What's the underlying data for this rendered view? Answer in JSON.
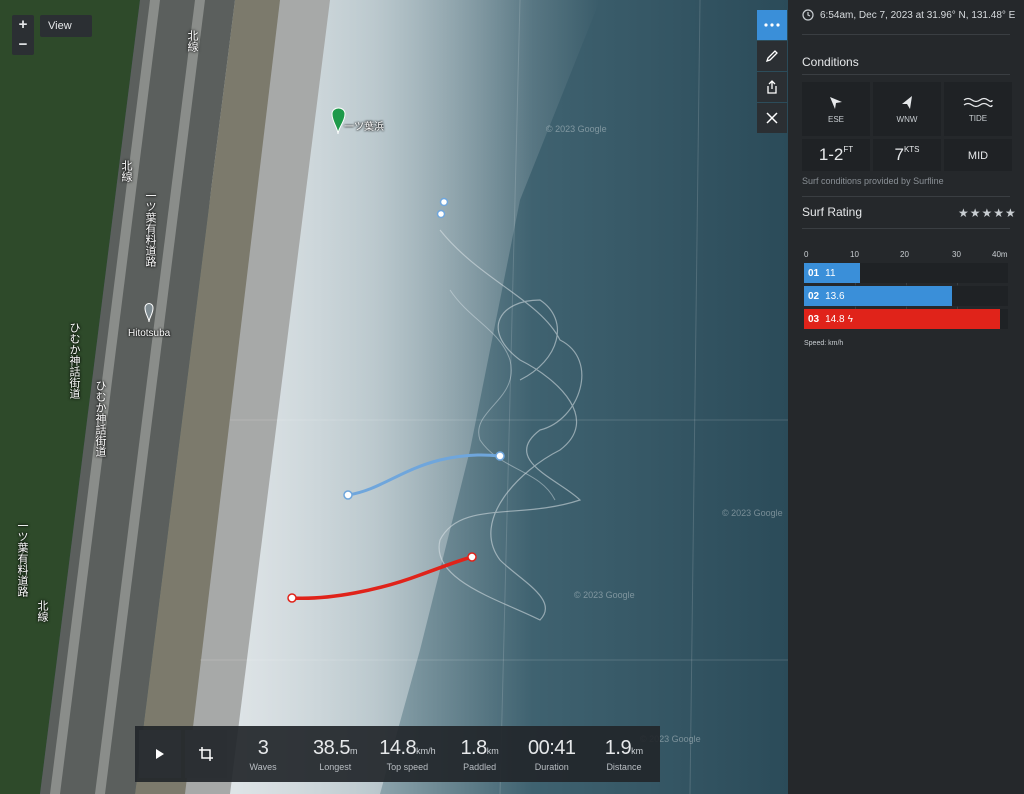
{
  "map": {
    "view_label": "View",
    "zoom_in": "+",
    "zoom_out": "−",
    "pin_label": "一ツ葉浜",
    "place_label": "Hitotsuba",
    "road_labels": [
      "北線",
      "北線",
      "一ツ葉有料道路",
      "ひむか神話街道",
      "ひむか神話街道",
      "一ツ葉有料道路",
      "北線"
    ],
    "watermarks": [
      "© 2023 Google",
      "© 2023 Google",
      "© 2023 Google",
      "© 2023 Google"
    ],
    "tools": [
      "more-icon",
      "pencil-icon",
      "share-icon",
      "close-icon"
    ],
    "wave_colors": {
      "blue": "#6fa6dc",
      "red": "#e03020"
    }
  },
  "stats": {
    "items": [
      {
        "value": "3",
        "unit": "",
        "label": "Waves"
      },
      {
        "value": "38.5",
        "unit": "m",
        "label": "Longest"
      },
      {
        "value": "14.8",
        "unit": "km/h",
        "label": "Top speed"
      },
      {
        "value": "1.8",
        "unit": "km",
        "label": "Paddled"
      },
      {
        "value": "00:41",
        "unit": "",
        "label": "Duration"
      },
      {
        "value": "1.9",
        "unit": "km",
        "label": "Distance"
      }
    ]
  },
  "panel": {
    "location": "6:54am, Dec 7, 2023 at 31.96° N, 131.48° E",
    "conditions_title": "Conditions",
    "conditions": [
      {
        "icon": "wind-arrow-icon",
        "label": "ESE"
      },
      {
        "icon": "swell-arrow-icon",
        "label": "WNW"
      },
      {
        "icon": "tide-waves-icon",
        "label": "TIDE"
      }
    ],
    "values": [
      {
        "big": "1-2",
        "sup": "FT"
      },
      {
        "big": "7",
        "sup": "KTS"
      },
      {
        "big": "MID",
        "sup": ""
      }
    ],
    "provided": "Surf conditions provided by Surfline",
    "rating_title": "Surf Rating",
    "stars": "★★★★★",
    "axis": [
      "0",
      "10",
      "20",
      "30",
      "40m"
    ],
    "speed_label": "Speed: km/h"
  },
  "chart_data": {
    "type": "bar",
    "categories": [
      "01",
      "02",
      "03"
    ],
    "values": [
      11,
      13.6,
      14.8
    ],
    "value_labels": [
      "11",
      "13.6",
      "14.8"
    ],
    "lengths_m": [
      11,
      29,
      38.5
    ],
    "colors": [
      "#3a8fd9",
      "#3a8fd9",
      "#e0231a"
    ],
    "xlim": [
      0,
      40
    ],
    "axis_unit": "m"
  }
}
